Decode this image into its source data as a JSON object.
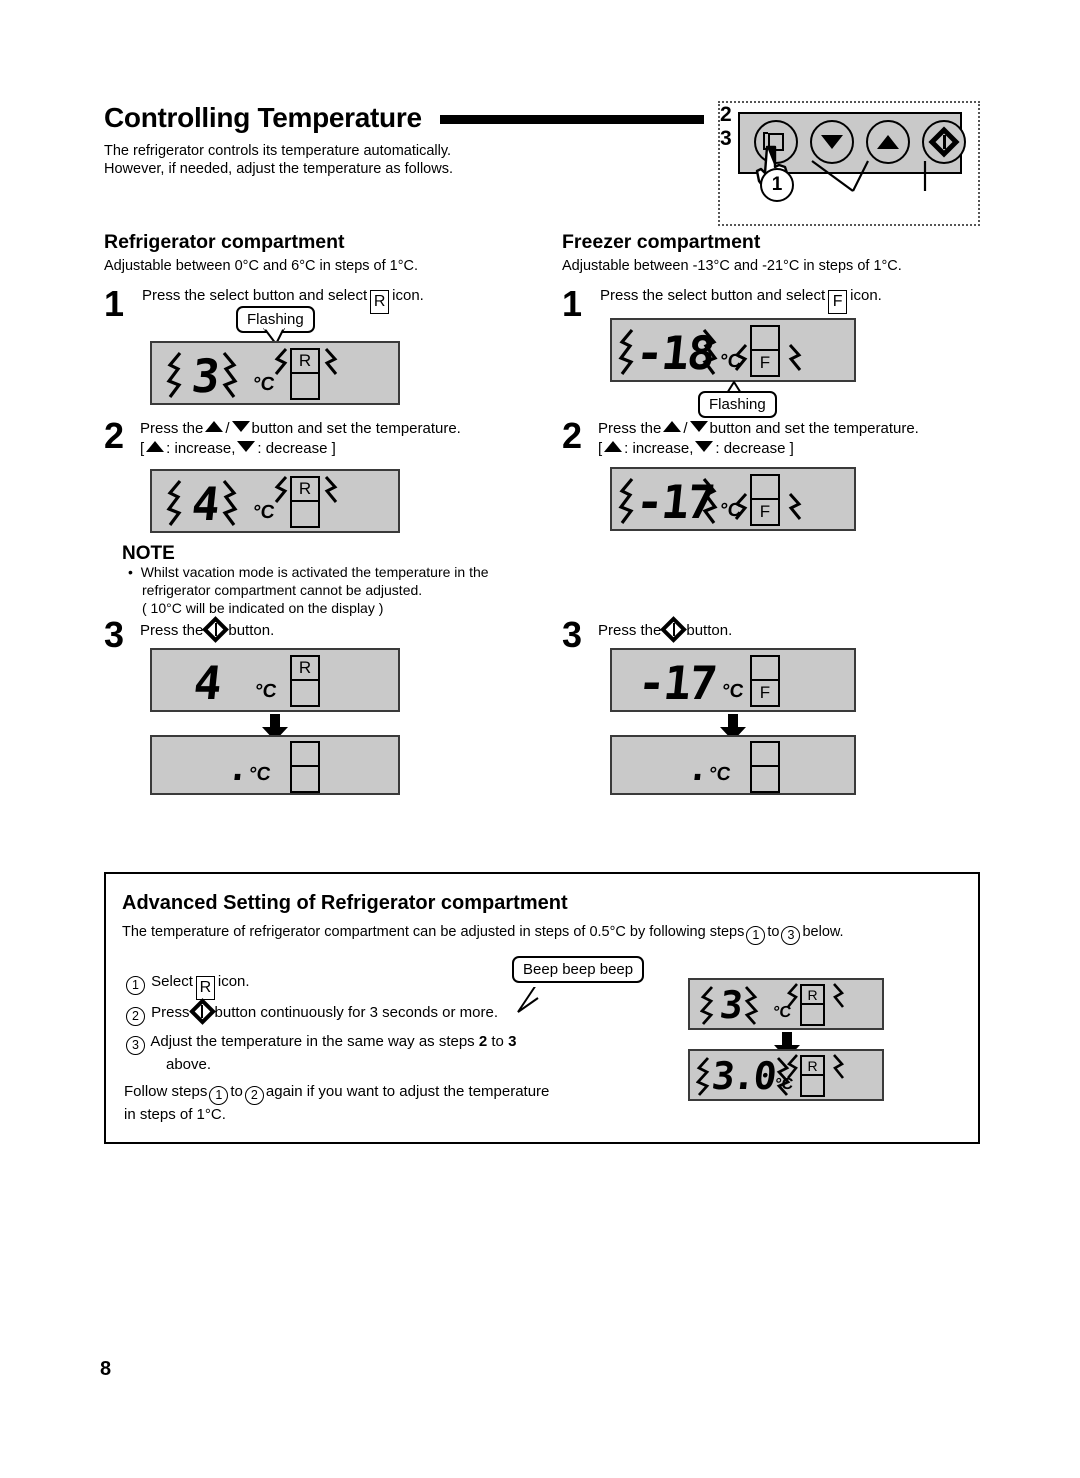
{
  "header": {
    "title": "Controlling Temperature",
    "intro_line1": "The refrigerator controls its temperature automatically.",
    "intro_line2": "However, if needed, adjust the temperature as follows."
  },
  "control_panel": {
    "buttons": [
      {
        "icon": "select-icon",
        "callout": "1"
      },
      {
        "icon": "down-arrow-icon",
        "callout": "2"
      },
      {
        "icon": "up-arrow-icon",
        "callout": "2"
      },
      {
        "icon": "set-diamond-icon",
        "callout": "3"
      }
    ],
    "label_1": "1",
    "label_2": "2",
    "label_3": "3"
  },
  "refrigerator": {
    "heading": "Refrigerator compartment",
    "range": "Adjustable between 0°C and 6°C in steps of 1°C.",
    "step1_num": "1",
    "step1_text_a": "Press the select button and select",
    "step1_icon": "R",
    "step1_text_b": "icon.",
    "step1_callout": "Flashing",
    "step1_display": {
      "value": "3",
      "unit": "°C",
      "indicator": "R",
      "indicator_pos": "top",
      "flashing": true
    },
    "step2_num": "2",
    "step2_line1_a": "Press the",
    "step2_line1_b": "/",
    "step2_line1_c": "button and set the temperature.",
    "step2_line2_a": "[",
    "step2_line2_b": ": increase,",
    "step2_line2_c": ": decrease ]",
    "step2_display": {
      "value": "4",
      "unit": "°C",
      "indicator": "R",
      "indicator_pos": "top",
      "flashing": true
    },
    "step3_num": "3",
    "step3_text_a": "Press the",
    "step3_text_b": "button.",
    "step3_display_before": {
      "value": "4",
      "unit": "°C",
      "indicator": "R",
      "indicator_pos": "top",
      "flashing": false
    },
    "step3_display_after": {
      "value": ".",
      "unit": "°C",
      "indicator": "",
      "indicator_pos": "none",
      "flashing": false
    }
  },
  "freezer": {
    "heading": "Freezer compartment",
    "range": "Adjustable between -13°C and -21°C in steps of 1°C.",
    "step1_num": "1",
    "step1_text_a": "Press the select button and select",
    "step1_icon": "F",
    "step1_text_b": "icon.",
    "step1_callout": "Flashing",
    "step1_display": {
      "value": "-18",
      "unit": "°C",
      "indicator": "F",
      "indicator_pos": "bottom",
      "flashing": true
    },
    "step2_num": "2",
    "step2_line1_a": "Press the",
    "step2_line1_b": "/",
    "step2_line1_c": "button and set the temperature.",
    "step2_line2_a": "[",
    "step2_line2_b": ": increase,",
    "step2_line2_c": ": decrease ]",
    "step2_display": {
      "value": "-17",
      "unit": "°C",
      "indicator": "F",
      "indicator_pos": "bottom",
      "flashing": true
    },
    "step3_num": "3",
    "step3_text_a": "Press the",
    "step3_text_b": "button.",
    "step3_display_before": {
      "value": "-17",
      "unit": "°C",
      "indicator": "F",
      "indicator_pos": "bottom",
      "flashing": false
    },
    "step3_display_after": {
      "value": ".",
      "unit": "°C",
      "indicator": "",
      "indicator_pos": "none",
      "flashing": false
    }
  },
  "note": {
    "heading": "NOTE",
    "line1": "Whilst vacation mode is activated the temperature in the",
    "line2": "refrigerator compartment cannot be adjusted.",
    "line3": "( 10°C will be indicated on the display )"
  },
  "advanced": {
    "heading": "Advanced Setting of Refrigerator compartment",
    "subtitle_a": "The temperature of refrigerator compartment can be adjusted in steps of 0.5°C by following steps",
    "subtitle_mark1": "1",
    "subtitle_to": "to",
    "subtitle_mark2": "3",
    "subtitle_b": "below.",
    "item1_mark": "1",
    "item1_a": "Select",
    "item1_icon": "R",
    "item1_b": "icon.",
    "item2_mark": "2",
    "item2_a": "Press",
    "item2_b": "button continuously for 3 seconds or more.",
    "item3_mark": "3",
    "item3_a": "Adjust the temperature in the same way as steps",
    "item3_bold1": "2",
    "item3_mid": "to",
    "item3_bold2": "3",
    "item3_b": "above.",
    "follow_a": "Follow steps",
    "follow_mark1": "1",
    "follow_to": "to",
    "follow_mark2": "2",
    "follow_b": "again if you want to adjust the temperature",
    "follow_c": "in steps of 1°C.",
    "beep_callout": "Beep beep beep",
    "display_before": {
      "value": "3",
      "unit": "°C",
      "indicator": "R",
      "indicator_pos": "top",
      "flashing": true
    },
    "display_after": {
      "value": "3.0",
      "unit": "°C",
      "indicator": "R",
      "indicator_pos": "top",
      "flashing": true
    }
  },
  "footer": {
    "page_number": "8"
  },
  "colors": {
    "lcd_background": "#c9c9c9",
    "lcd_border": "#3a3a3a",
    "ink": "#000000"
  }
}
